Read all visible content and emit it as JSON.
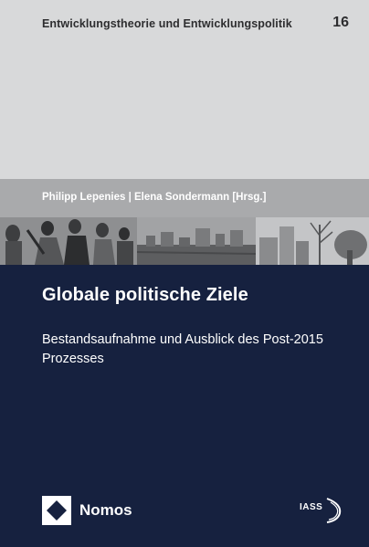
{
  "series": {
    "title": "Entwicklungstheorie und Entwicklungspolitik",
    "volume": "16"
  },
  "authors": "Philipp Lepenies | Elena Sondermann [Hrsg.]",
  "book": {
    "title": "Globale politische Ziele",
    "subtitle": "Bestandsaufnahme und Ausblick des Post-2015 Prozesses"
  },
  "publisher": {
    "name": "Nomos",
    "logo_icon": "nomos-diamond-logo-icon"
  },
  "partner": {
    "name": "IASS",
    "logo_icon": "iass-swoosh-logo-icon"
  },
  "colors": {
    "top_band": "#d8d9da",
    "author_band": "#a9aaac",
    "navy": "#16213f",
    "series_text": "#2d2d2f",
    "light_text": "#ffffff"
  }
}
